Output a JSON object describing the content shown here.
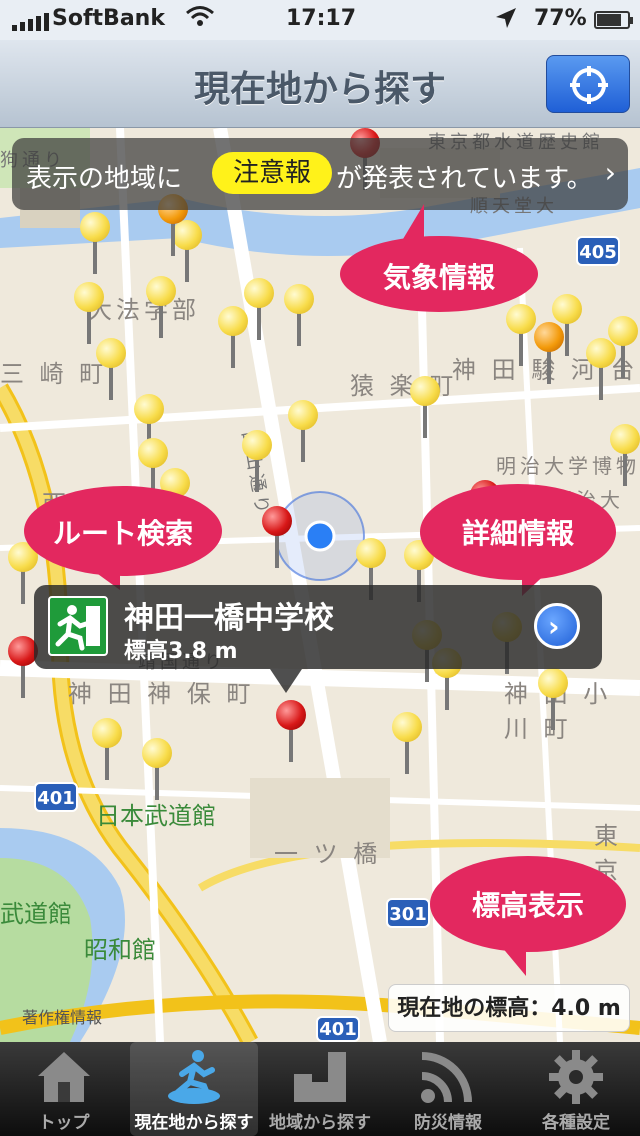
{
  "status_bar": {
    "carrier": "SoftBank",
    "time": "17:17",
    "battery": "77%"
  },
  "nav": {
    "title": "現在地から探す",
    "locate_button_icon": "location-target-icon"
  },
  "alert_banner": {
    "prefix": "表示の地域に",
    "badge": "注意報",
    "suffix": "が発表されています。",
    "chevron": "›"
  },
  "bubbles": {
    "weather": "気象情報",
    "route": "ルート検索",
    "detail": "詳細情報",
    "elevation": "標高表示"
  },
  "map_labels": {
    "l1": "東京都水道歴史館",
    "l2": "順天堂大",
    "l3": "大法学部",
    "l4": "三 崎 町",
    "l5": "猿 楽 町",
    "l6": "神 田 駿 河 台",
    "l7": "白山通り",
    "l8": "明治大学博物",
    "l9": "明治大",
    "l10": "西 神 田",
    "l11": "靖国通り",
    "l12": "神 田 神 保 町",
    "l13": "神 田 小 川 町",
    "l14": "日本武道館",
    "l15": "一 ツ 橋",
    "l16": "東京",
    "l17": "武道館",
    "l18": "昭和館",
    "l19": "狗通り",
    "shield_405": "405",
    "shield_401a": "401",
    "shield_301": "301",
    "shield_401b": "401"
  },
  "callout": {
    "name": "神田一橋中学校",
    "elevation": "標高3.8 m",
    "detail_glyph": "›"
  },
  "current_elevation": "現在地の標高：4.0 m",
  "copyright": "著作権情報",
  "tabs": [
    {
      "label": "トップ",
      "icon": "home-icon"
    },
    {
      "label": "現在地から探す",
      "icon": "running-person-icon"
    },
    {
      "label": "地域から探す",
      "icon": "city-icon"
    },
    {
      "label": "防災情報",
      "icon": "rss-icon"
    },
    {
      "label": "各種設定",
      "icon": "gear-icon"
    }
  ],
  "colors": {
    "bubble": "#e3285f",
    "alert_badge": "#fff21a",
    "nav_button": "#1f5fd6"
  }
}
